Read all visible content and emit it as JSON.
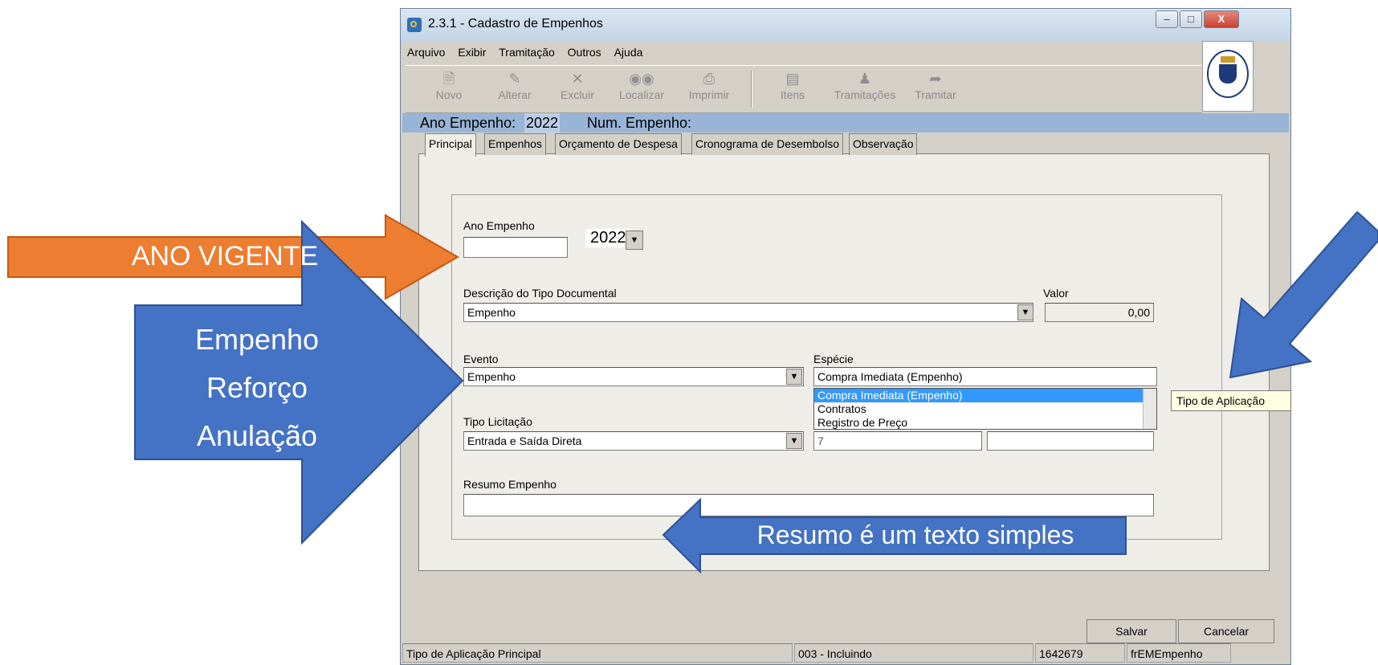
{
  "window": {
    "title": "2.3.1 - Cadastro de Empenhos",
    "close_glyph": "X"
  },
  "menu": [
    "Arquivo",
    "Exibir",
    "Tramitação",
    "Outros",
    "Ajuda"
  ],
  "toolbar": [
    {
      "label": "Novo",
      "icon": "document-icon"
    },
    {
      "label": "Alterar",
      "icon": "edit-icon"
    },
    {
      "label": "Excluir",
      "icon": "delete-icon"
    },
    {
      "label": "Localizar",
      "icon": "binoculars-icon"
    },
    {
      "label": "Imprimir",
      "icon": "printer-icon"
    },
    {
      "label": "Itens",
      "icon": "items-icon"
    },
    {
      "label": "Tramitações",
      "icon": "people-icon"
    },
    {
      "label": "Tramitar",
      "icon": "send-icon"
    }
  ],
  "header_bar": {
    "ano_label": "Ano Empenho:",
    "ano_value": "2022",
    "num_label": "Num. Empenho:"
  },
  "tabs": [
    "Principal",
    "Empenhos",
    "Orçamento de Despesa",
    "Cronograma de Desembolso",
    "Observação"
  ],
  "form": {
    "ano_empenho_label": "Ano Empenho",
    "ano_empenho_value": "2022",
    "descricao_label": "Descrição do Tipo Documental",
    "descricao_value": "Empenho",
    "valor_label": "Valor",
    "valor_value": "0,00",
    "evento_label": "Evento",
    "evento_value": "Empenho",
    "especie_label": "Espécie",
    "especie_value": "Compra Imediata (Empenho)",
    "especie_options": [
      "Compra Imediata (Empenho)",
      "Contratos",
      "Registro de Preço"
    ],
    "tipo_licitacao_label": "Tipo Licitação",
    "tipo_licitacao_value": "Entrada e Saída Direta",
    "partial_field_value": "7",
    "resumo_label": "Resumo Empenho"
  },
  "tooltip": "Tipo de Aplicação",
  "buttons": {
    "salvar": "Salvar",
    "cancelar": "Cancelar"
  },
  "status_bar": [
    "Tipo de Aplicação Principal",
    "003 - Incluindo",
    "1642679",
    "frEMEmpenho"
  ],
  "annotations": {
    "ano_vigente": "ANO VIGENTE",
    "evento_tipos": [
      "Empenho",
      "Reforço",
      "Anulação"
    ],
    "resumo_note": "Resumo é um texto simples"
  },
  "colors": {
    "orange_arrow": "#ed7d31",
    "blue_arrow": "#4472c4",
    "header_bar": "#98b4d6"
  }
}
